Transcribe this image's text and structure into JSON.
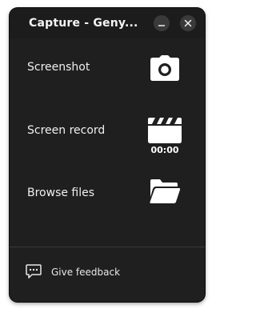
{
  "window": {
    "title": "Capture - Geny...",
    "background": "#1f1f1f"
  },
  "titlebar": {
    "minimize_icon": "minimize-icon",
    "close_icon": "close-icon"
  },
  "menu": {
    "screenshot": {
      "label": "Screenshot",
      "icon": "camera-icon"
    },
    "screen_record": {
      "label": "Screen record",
      "icon": "clapperboard-icon",
      "timer": "00:00"
    },
    "browse_files": {
      "label": "Browse files",
      "icon": "folder-open-icon"
    }
  },
  "footer": {
    "feedback_label": "Give feedback",
    "feedback_icon": "chat-bubble-icon"
  }
}
